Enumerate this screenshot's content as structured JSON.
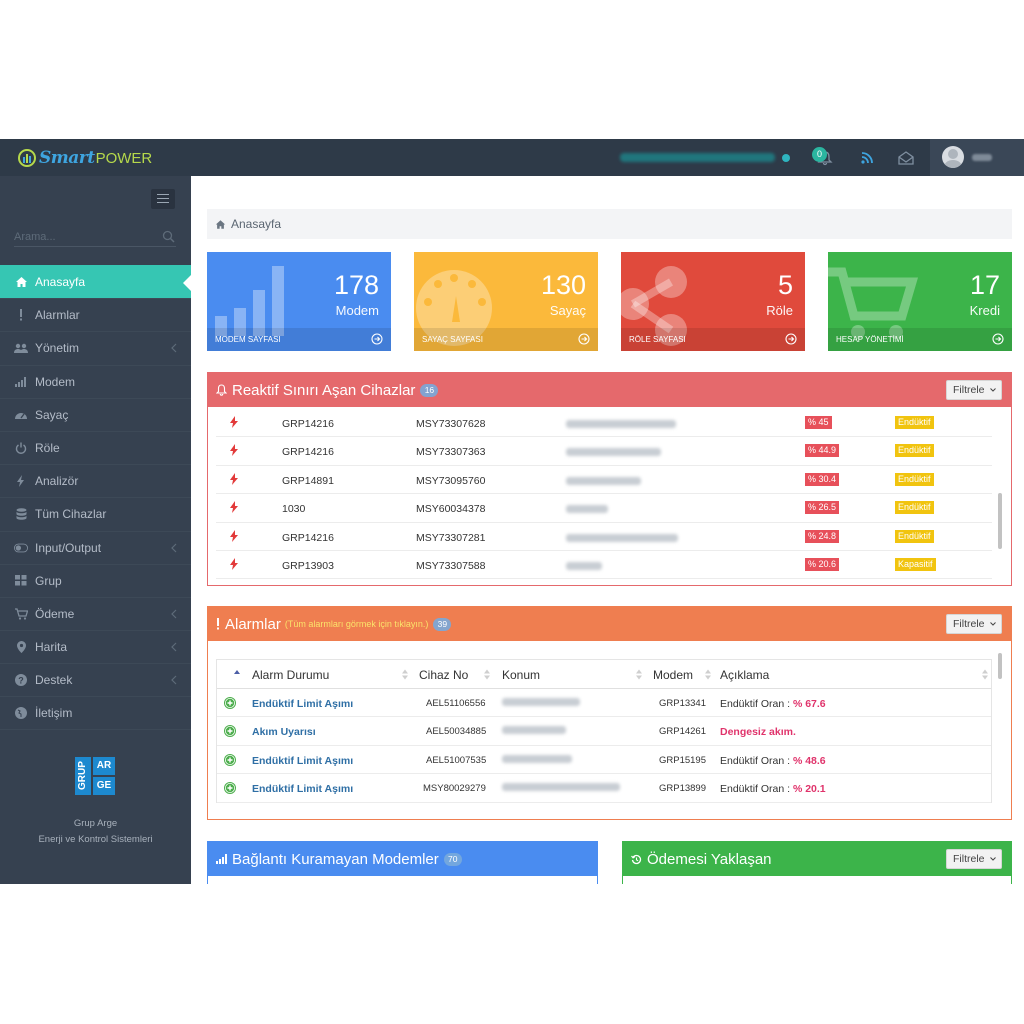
{
  "header": {
    "brand_smart": "Smart",
    "brand_power": "POWER",
    "notifications_count": "0"
  },
  "sidebar": {
    "search_placeholder": "Arama...",
    "items": [
      {
        "label": "Anasayfa",
        "icon": "home-icon",
        "active": true,
        "has_submenu": false
      },
      {
        "label": "Alarmlar",
        "icon": "exclamation-icon",
        "active": false,
        "has_submenu": false
      },
      {
        "label": "Yönetim",
        "icon": "users-icon",
        "active": false,
        "has_submenu": true
      },
      {
        "label": "Modem",
        "icon": "signal-icon",
        "active": false,
        "has_submenu": false
      },
      {
        "label": "Sayaç",
        "icon": "dashboard-icon",
        "active": false,
        "has_submenu": false
      },
      {
        "label": "Röle",
        "icon": "power-icon",
        "active": false,
        "has_submenu": false
      },
      {
        "label": "Analizör",
        "icon": "bolt-icon",
        "active": false,
        "has_submenu": false
      },
      {
        "label": "Tüm Cihazlar",
        "icon": "database-icon",
        "active": false,
        "has_submenu": false
      },
      {
        "label": "Input/Output",
        "icon": "toggle-icon",
        "active": false,
        "has_submenu": true
      },
      {
        "label": "Grup",
        "icon": "grid-icon",
        "active": false,
        "has_submenu": false
      },
      {
        "label": "Ödeme",
        "icon": "cart-icon",
        "active": false,
        "has_submenu": true
      },
      {
        "label": "Harita",
        "icon": "map-marker-icon",
        "active": false,
        "has_submenu": true
      },
      {
        "label": "Destek",
        "icon": "question-icon",
        "active": false,
        "has_submenu": true
      },
      {
        "label": "İletişim",
        "icon": "globe-icon",
        "active": false,
        "has_submenu": false
      }
    ],
    "logo": {
      "g": "GRUP",
      "a": "AR",
      "e": "GE"
    },
    "company_line1": "Grup Arge",
    "company_line2": "Enerji ve Kontrol Sistemleri"
  },
  "breadcrumb": {
    "home": "Anasayfa"
  },
  "stats": [
    {
      "number": "178",
      "label": "Modem",
      "footer": "MODEM SAYFASI",
      "color": "#4a8cf0"
    },
    {
      "number": "130",
      "label": "Sayaç",
      "footer": "SAYAÇ SAYFASI",
      "color": "#fbb93b"
    },
    {
      "number": "5",
      "label": "Röle",
      "footer": "RÖLE SAYFASI",
      "color": "#e04a3c"
    },
    {
      "number": "17",
      "label": "Kredi",
      "footer": "HESAP YÖNETİMİ",
      "color": "#3cb44a"
    }
  ],
  "reaktif": {
    "title": "Reaktif Sınırı Aşan Cihazlar",
    "count": "16",
    "filter": "Filtrele",
    "rows": [
      {
        "grp": "GRP14216",
        "msy": "MSY73307628",
        "pct": "% 45",
        "type": "Endüktif"
      },
      {
        "grp": "GRP14216",
        "msy": "MSY73307363",
        "pct": "% 44.9",
        "type": "Endüktif"
      },
      {
        "grp": "GRP14891",
        "msy": "MSY73095760",
        "pct": "% 30.4",
        "type": "Endüktif"
      },
      {
        "grp": "1030",
        "msy": "MSY60034378",
        "pct": "% 26.5",
        "type": "Endüktif"
      },
      {
        "grp": "GRP14216",
        "msy": "MSY73307281",
        "pct": "% 24.8",
        "type": "Endüktif"
      },
      {
        "grp": "GRP13903",
        "msy": "MSY73307588",
        "pct": "% 20.6",
        "type": "Kapasitif"
      }
    ]
  },
  "alarmlar": {
    "title": "Alarmlar",
    "subtitle": "(Tüm alarmları görmek için tıklayın.)",
    "count": "39",
    "filter": "Filtrele",
    "columns": [
      "Alarm Durumu",
      "Cihaz No",
      "Konum",
      "Modem",
      "Açıklama"
    ],
    "rows": [
      {
        "durum": "Endüktif Limit Aşımı",
        "cihaz": "AEL51106556",
        "modem": "GRP13341",
        "aciklama": "Endüktif Oran : ",
        "value": "% 67.6"
      },
      {
        "durum": "Akım Uyarısı",
        "cihaz": "AEL50034885",
        "modem": "GRP14261",
        "aciklama": "",
        "value": "Dengesiz akım."
      },
      {
        "durum": "Endüktif Limit Aşımı",
        "cihaz": "AEL51007535",
        "modem": "GRP15195",
        "aciklama": "Endüktif Oran : ",
        "value": "% 48.6"
      },
      {
        "durum": "Endüktif Limit Aşımı",
        "cihaz": "MSY80029279",
        "modem": "GRP13899",
        "aciklama": "Endüktif Oran : ",
        "value": "% 20.1"
      }
    ]
  },
  "baglanti": {
    "title": "Bağlantı Kuramayan Modemler",
    "count": "70"
  },
  "odemesi": {
    "title": "Ödemesi Yaklaşan",
    "filter": "Filtrele"
  }
}
